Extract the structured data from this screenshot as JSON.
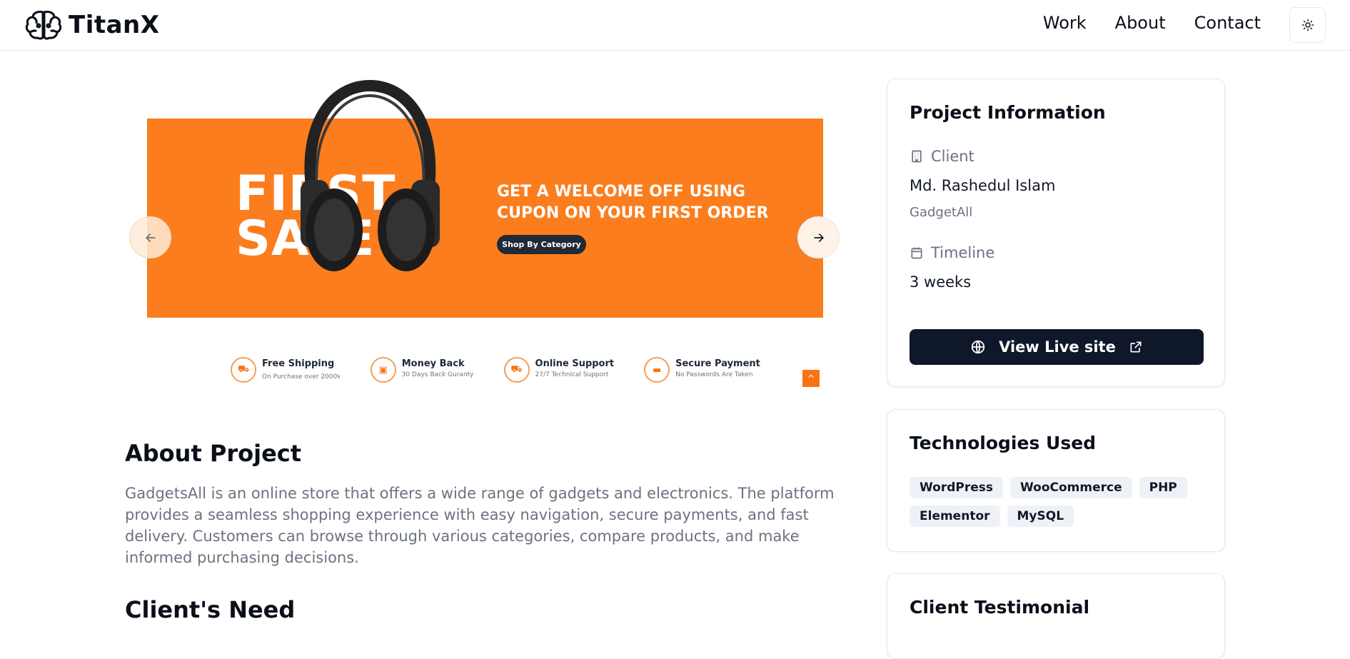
{
  "nav": {
    "brand": "TitanX",
    "links": [
      "Work",
      "About",
      "Contact"
    ]
  },
  "carousel": {
    "banner_big_text": "FIRST SALE",
    "banner_headline_1": "GET A WELCOME OFF USING",
    "banner_headline_2": "CUPON ON YOUR FIRST ORDER",
    "banner_button": "Shop By Category",
    "features": [
      {
        "title": "Free Shipping",
        "subtitle": "On Purchase over 2000৳",
        "icon": "truck-icon"
      },
      {
        "title": "Money Back",
        "subtitle": "30 Days Back Guranty",
        "icon": "money-icon"
      },
      {
        "title": "Online Support",
        "subtitle": "27/7 Technical Support",
        "icon": "truck-icon"
      },
      {
        "title": "Secure Payment",
        "subtitle": "No Passwords Are Taken",
        "icon": "card-icon"
      }
    ],
    "accent_color": "#fb7d1d"
  },
  "about": {
    "title": "About Project",
    "text": "GadgetsAll is an online store that offers a wide range of gadgets and electronics. The platform provides a seamless shopping experience with easy navigation, secure payments, and fast delivery. Customers can browse through various categories, compare products, and make informed purchasing decisions."
  },
  "need": {
    "title": "Client's Need"
  },
  "project_info": {
    "title": "Project Information",
    "client_label": "Client",
    "client_name": "Md. Rashedul Islam",
    "client_company": "GadgetAll",
    "timeline_label": "Timeline",
    "timeline_value": "3 weeks",
    "live_button": "View Live site"
  },
  "tech": {
    "title": "Technologies Used",
    "tags": [
      "WordPress",
      "WooCommerce",
      "PHP",
      "Elementor",
      "MySQL"
    ]
  },
  "testimonial": {
    "title": "Client Testimonial"
  },
  "colors": {
    "primary_dark": "#0f172a",
    "muted": "#6b7280"
  }
}
